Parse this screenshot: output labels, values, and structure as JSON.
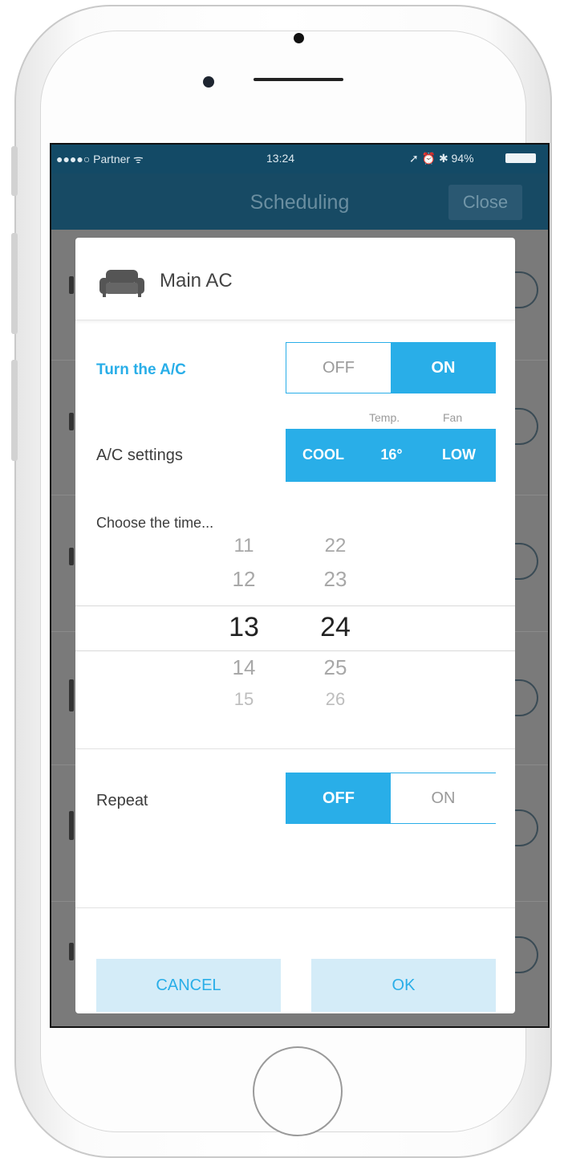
{
  "status_bar": {
    "carrier": "●●●●○ Partner ᯤ",
    "time": "13:24",
    "right": "➚ ⏰ ✱ 94%",
    "battery_level": 0.94
  },
  "nav": {
    "title": "Scheduling",
    "close_label": "Close"
  },
  "dialog": {
    "device_name": "Main AC",
    "device_icon": "sofa-icon",
    "turn_ac": {
      "label": "Turn the A/C",
      "off_label": "OFF",
      "on_label": "ON",
      "selected": "ON"
    },
    "ac_settings": {
      "label": "A/C settings",
      "temp_caption": "Temp.",
      "fan_caption": "Fan",
      "mode": "COOL",
      "temp": "16°",
      "fan": "LOW"
    },
    "time": {
      "label": "Choose the time...",
      "hours": [
        "11",
        "12",
        "13",
        "14",
        "15"
      ],
      "minutes": [
        "22",
        "23",
        "24",
        "25",
        "26"
      ],
      "selected_hour": "13",
      "selected_minute": "24"
    },
    "repeat": {
      "label": "Repeat",
      "off_label": "OFF",
      "on_label": "ON",
      "selected": "OFF"
    },
    "cancel_label": "CANCEL",
    "ok_label": "OK"
  },
  "colors": {
    "accent": "#29aee8",
    "navbar": "#174a64",
    "button_bg": "#d4ecf8"
  }
}
